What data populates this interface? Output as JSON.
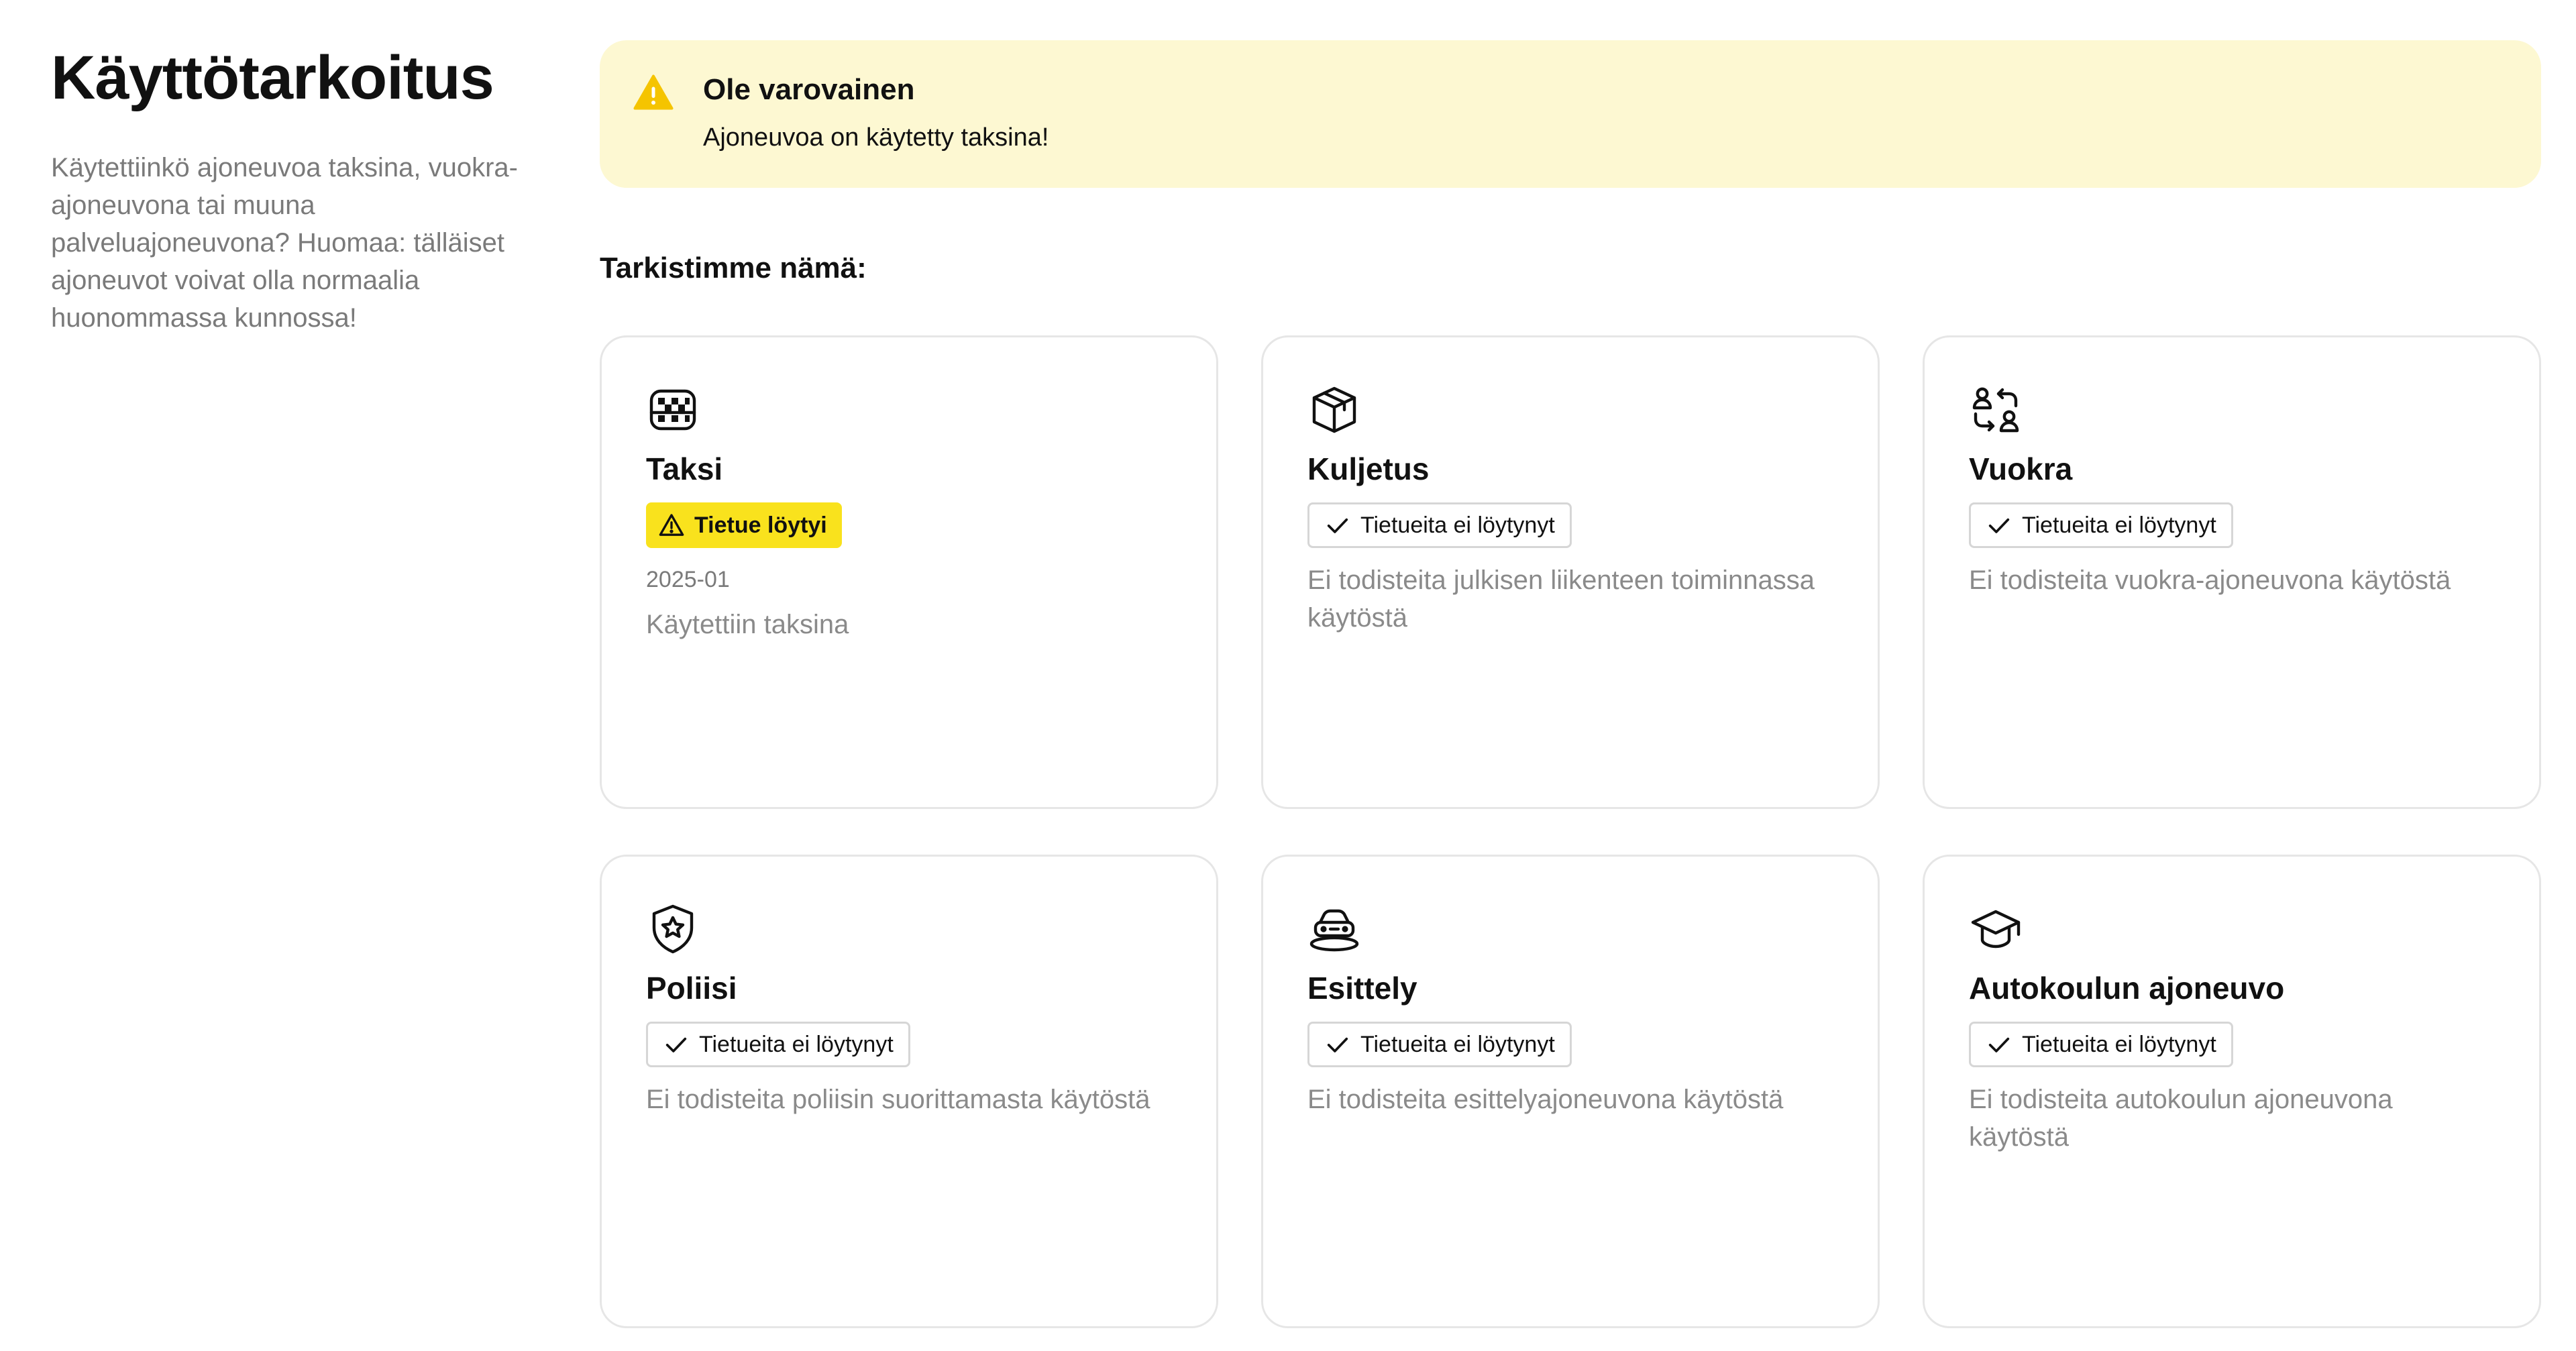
{
  "sidebar": {
    "title": "Käyttötarkoitus",
    "description": "Käytettiinkö ajoneuvoa taksina, vuokra-ajoneuvona tai muuna palveluajoneuvona? Huomaa: tälläiset ajoneuvot voivat olla normaalia huonommassa kunnossa!"
  },
  "alert": {
    "icon": "warning-triangle-icon",
    "title": "Ole varovainen",
    "message": "Ajoneuvoa on käytetty taksina!",
    "background_color": "#fdf8d2",
    "icon_color": "#f5c400"
  },
  "checks": {
    "heading": "Tarkistimme nämä:",
    "cards": [
      {
        "icon": "taxi-icon",
        "title": "Taksi",
        "badge": "Tietue löytyi",
        "status": "found",
        "date": "2025-01",
        "description": "Käytettiin taksina"
      },
      {
        "icon": "package-box-icon",
        "title": "Kuljetus",
        "badge": "Tietueita ei löytynyt",
        "status": "not-found",
        "description": "Ei todisteita julkisen liikenteen toiminnassa käytöstä"
      },
      {
        "icon": "user-swap-icon",
        "title": "Vuokra",
        "badge": "Tietueita ei löytynyt",
        "status": "not-found",
        "description": "Ei todisteita vuokra-ajoneuvona käytöstä"
      },
      {
        "icon": "police-badge-icon",
        "title": "Poliisi",
        "badge": "Tietueita ei löytynyt",
        "status": "not-found",
        "description": "Ei todisteita poliisin suorittamasta käytöstä"
      },
      {
        "icon": "showcase-car-icon",
        "title": "Esittely",
        "badge": "Tietueita ei löytynyt",
        "status": "not-found",
        "description": "Ei todisteita esittelyajoneuvona käytöstä"
      },
      {
        "icon": "graduation-cap-icon",
        "title": "Autokoulun ajoneuvo",
        "badge": "Tietueita ei löytynyt",
        "status": "not-found",
        "description": "Ei todisteita autokoulun ajoneuvona käytöstä"
      }
    ]
  },
  "colors": {
    "warning_badge": "#f9e21d",
    "card_border": "#e6e6e6",
    "muted_text": "#7a7a7a"
  }
}
